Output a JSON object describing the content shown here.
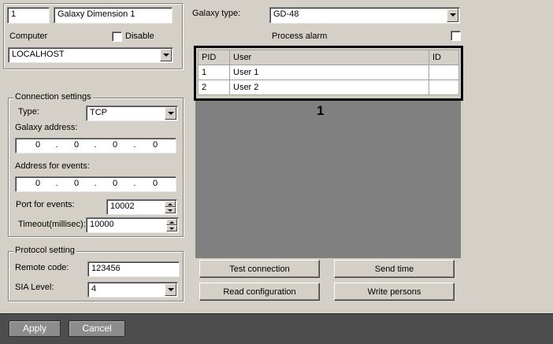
{
  "device": {
    "id": "1",
    "name": "Galaxy Dimension 1",
    "computer_label": "Computer",
    "disable_label": "Disable",
    "computer_value": "LOCALHOST"
  },
  "connection": {
    "title": "Connection settings",
    "type_label": "Type:",
    "type_value": "TCP",
    "galaxy_address_label": "Galaxy address:",
    "galaxy_address": [
      "0",
      "0",
      "0",
      "0"
    ],
    "events_address_label": "Address for events:",
    "events_address": [
      "0",
      "0",
      "0",
      "0"
    ],
    "port_label": "Port for events:",
    "port_value": "10002",
    "timeout_label": "Timeout(millisec):",
    "timeout_value": "10000"
  },
  "protocol": {
    "title": "Protocol setting",
    "remote_code_label": "Remote code:",
    "remote_code_value": "123456",
    "sia_label": "SIA Level:",
    "sia_value": "4"
  },
  "galaxy": {
    "type_label": "Galaxy type:",
    "type_value": "GD-48",
    "process_alarm_label": "Process alarm"
  },
  "table": {
    "columns": [
      "PID",
      "User",
      "ID"
    ],
    "rows": [
      [
        "1",
        "User 1",
        ""
      ],
      [
        "2",
        "User 2",
        ""
      ]
    ],
    "callout": "1"
  },
  "actions": {
    "test_connection": "Test connection",
    "send_time": "Send time",
    "read_configuration": "Read configuration",
    "write_persons": "Write persons"
  },
  "footer": {
    "apply": "Apply",
    "cancel": "Cancel"
  }
}
